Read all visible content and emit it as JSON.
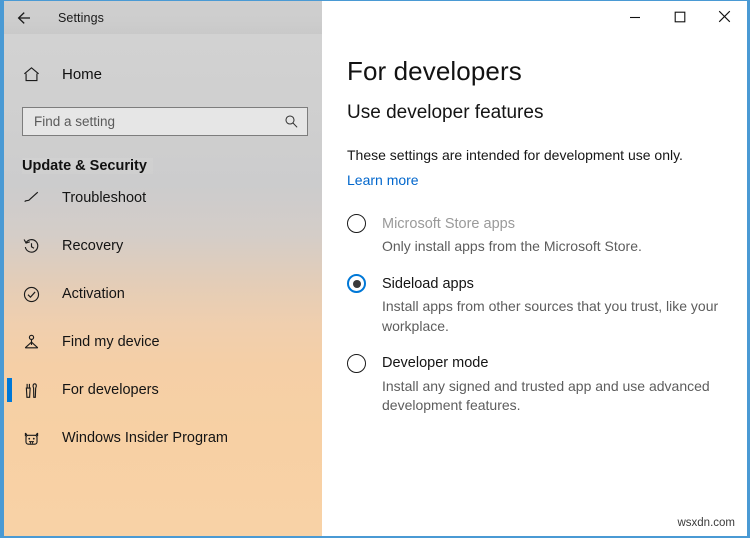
{
  "window": {
    "app_title": "Settings",
    "back_icon": "back-arrow-icon",
    "accent_color": "#0078d7",
    "border_color": "#4a9ad4",
    "controls": {
      "minimize_label": "—",
      "maximize_label": "□",
      "close_label": "✕"
    }
  },
  "sidebar": {
    "home": {
      "label": "Home",
      "icon": "home-icon"
    },
    "search": {
      "placeholder": "Find a setting",
      "value": "",
      "icon": "search-icon"
    },
    "section_header": "Update & Security",
    "items": [
      {
        "label": "Troubleshoot",
        "icon": "troubleshoot-icon",
        "selected": false
      },
      {
        "label": "Recovery",
        "icon": "recovery-history-icon",
        "selected": false
      },
      {
        "label": "Activation",
        "icon": "activation-check-icon",
        "selected": false
      },
      {
        "label": "Find my device",
        "icon": "find-my-device-icon",
        "selected": false
      },
      {
        "label": "For developers",
        "icon": "developer-tools-icon",
        "selected": true
      },
      {
        "label": "Windows Insider Program",
        "icon": "insider-bug-icon",
        "selected": false
      }
    ]
  },
  "main": {
    "page_title": "For developers",
    "section_title": "Use developer features",
    "intro_text": "These settings are intended for development use only.",
    "learn_more_label": "Learn more",
    "options": [
      {
        "label": "Microsoft Store apps",
        "description": "Only install apps from the Microsoft Store.",
        "checked": false,
        "disabled": true
      },
      {
        "label": "Sideload apps",
        "description": "Install apps from other sources that you trust, like your workplace.",
        "checked": true,
        "disabled": false
      },
      {
        "label": "Developer mode",
        "description": "Install any signed and trusted app and use advanced development features.",
        "checked": false,
        "disabled": false
      }
    ]
  },
  "watermark": {
    "text": "wsxdn.com"
  }
}
